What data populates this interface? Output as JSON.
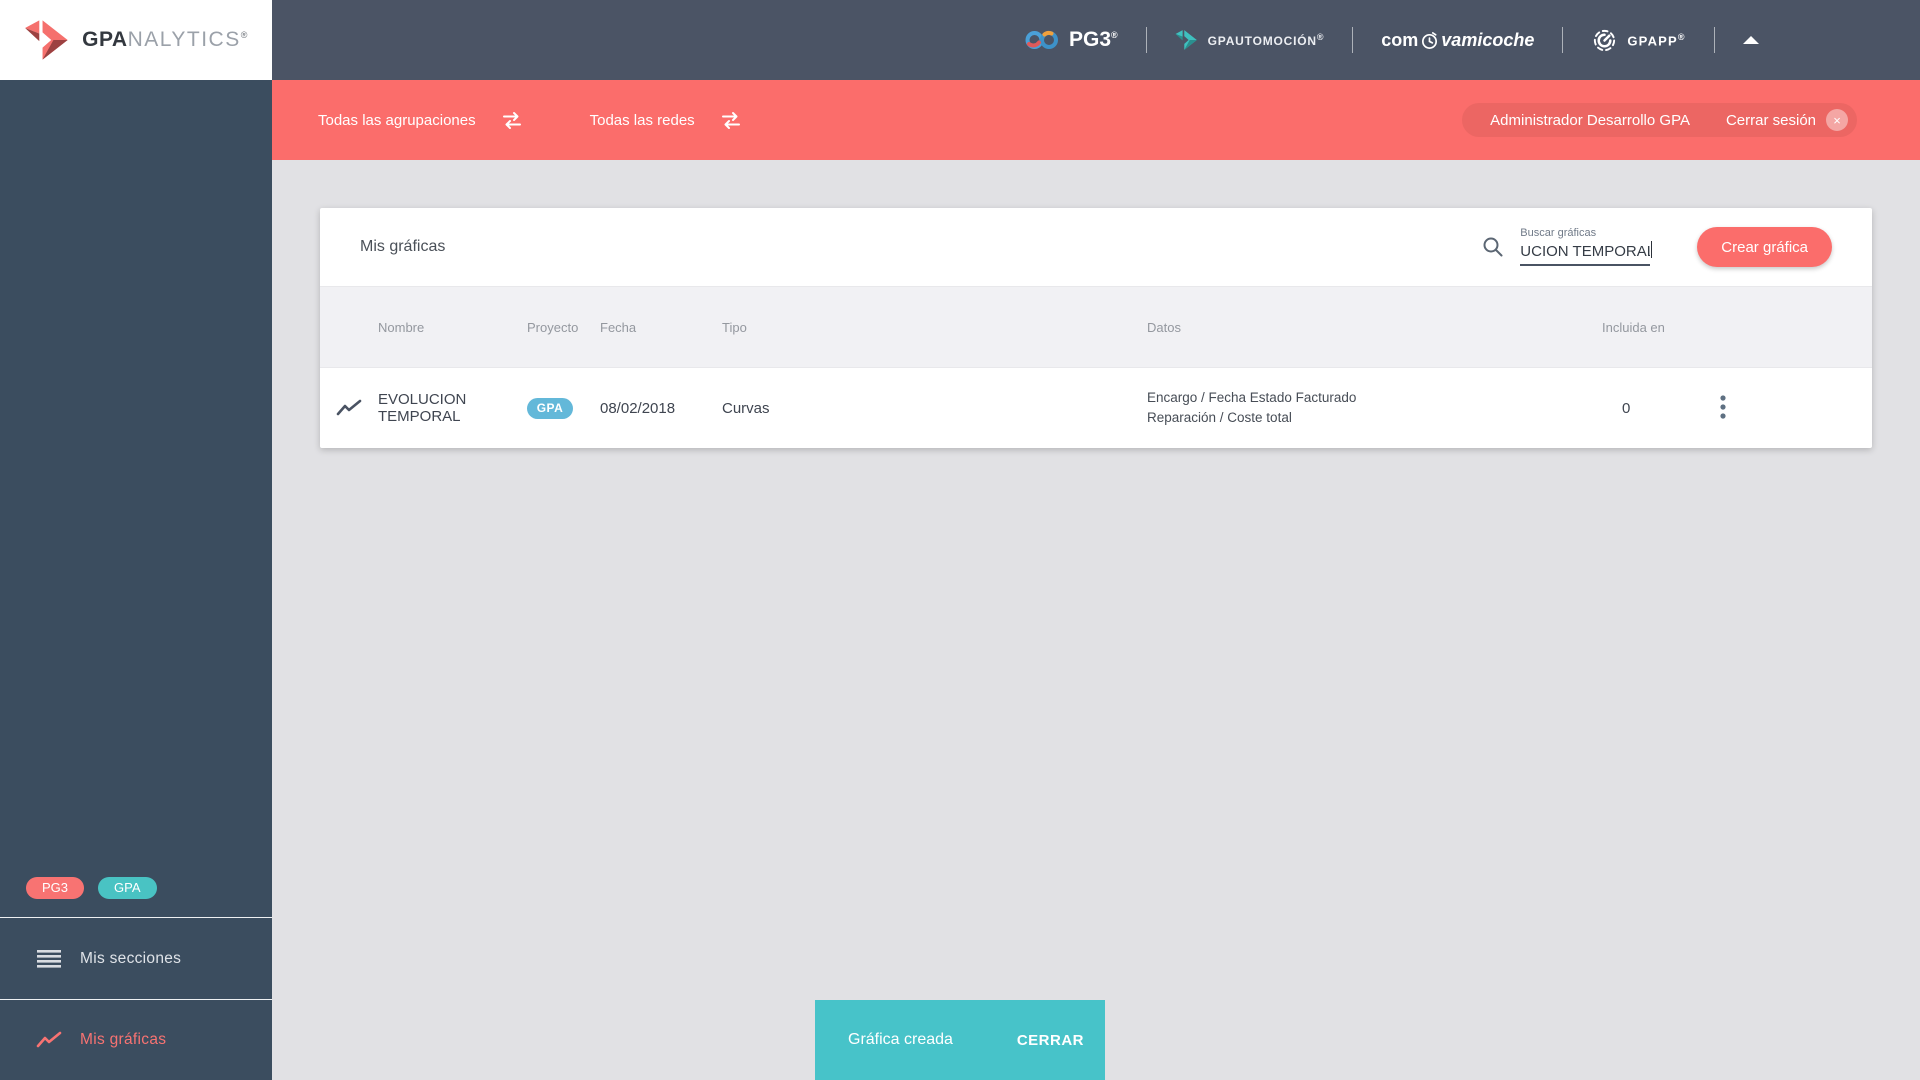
{
  "colors": {
    "accent_red": "#fb6d6b",
    "header_dark": "#4b5465",
    "sidebar_dark": "#3b4d5f",
    "teal_chip": "#49c3c3",
    "badge_blue": "#63b8d9",
    "snackbar_teal": "#47c3c9",
    "main_bg": "#e1e1e4"
  },
  "brand": {
    "bold": "GPA",
    "rest": "NALYTICS",
    "reg": "®"
  },
  "topbar": {
    "pg3": "PG3",
    "pg3_reg": "®",
    "automocion": "GPAUTOMOCIÓN",
    "automocion_reg": "®",
    "coche_pre": "com",
    "coche_post": "vamicoche",
    "gpapp": "GPAPP",
    "gpapp_reg": "®"
  },
  "filterbar": {
    "groupings": "Todas las agrupaciones",
    "networks": "Todas las redes",
    "admin": "Administrador Desarrollo GPA",
    "logout": "Cerrar sesión",
    "logout_x": "×"
  },
  "sidebar": {
    "badge_pg3": "PG3",
    "badge_gpa": "GPA",
    "sections": "Mis secciones",
    "charts": "Mis gráficas"
  },
  "card": {
    "title": "Mis gráficas",
    "search_label": "Buscar gráficas",
    "search_value": "UCION TEMPORAL",
    "create": "Crear gráfica"
  },
  "table": {
    "headers": {
      "name": "Nombre",
      "project": "Proyecto",
      "date": "Fecha",
      "type": "Tipo",
      "data": "Datos",
      "included": "Incluida en"
    },
    "rows": [
      {
        "name": "EVOLUCION TEMPORAL",
        "project_badge": "GPA",
        "date": "08/02/2018",
        "type": "Curvas",
        "data_line1": "Encargo / Fecha Estado Facturado",
        "data_line2": "Reparación / Coste total",
        "included": "0"
      }
    ]
  },
  "snackbar": {
    "message": "Gráfica creada",
    "action": "CERRAR"
  },
  "icons": {
    "swap": "swap-arrows",
    "chart": "line-chart",
    "menu": "hamburger",
    "search": "magnifier",
    "more": "vertical-dots",
    "close": "x-circle"
  }
}
